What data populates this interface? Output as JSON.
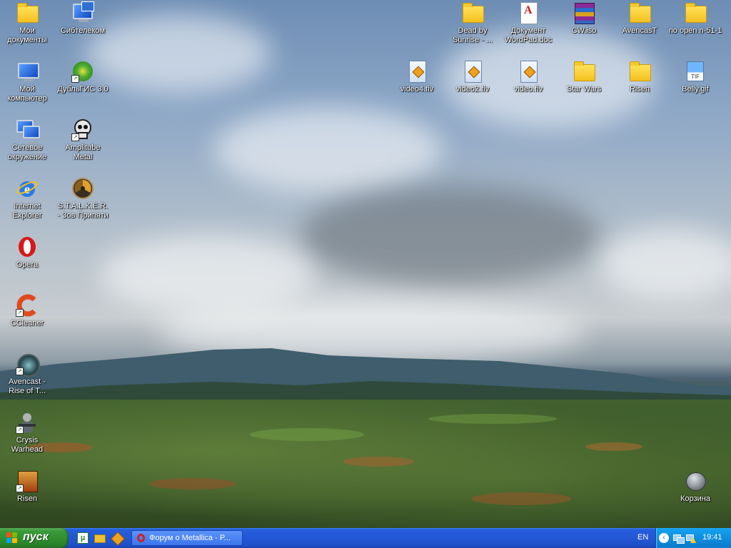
{
  "desktop": {
    "icons_left": [
      {
        "label": "Мои\nдокументы",
        "icon": "folder-documents-icon"
      },
      {
        "label": "Мой\nкомпьютер",
        "icon": "computer-icon"
      },
      {
        "label": "Сетевое\nокружение",
        "icon": "network-icon"
      },
      {
        "label": "Internet\nExplorer",
        "icon": "internet-explorer-icon"
      },
      {
        "label": "Opera",
        "icon": "opera-icon"
      },
      {
        "label": "CCleaner",
        "icon": "ccleaner-icon"
      },
      {
        "label": "Avencast -\nRise of T...",
        "icon": "avencast-icon"
      },
      {
        "label": "Crysis\nWarhead",
        "icon": "crysis-icon"
      },
      {
        "label": "Risen",
        "icon": "risen-game-icon"
      }
    ],
    "icons_second": [
      {
        "label": "Сибтелеком",
        "icon": "sibtelecom-icon"
      },
      {
        "label": "ДубльГИС 3.0",
        "icon": "doublegis-icon"
      },
      {
        "label": "Amplitube\nMetal",
        "icon": "amplitube-icon"
      },
      {
        "label": "S.T.A.L.K.E.R.\n- Зов Припяти",
        "icon": "stalker-icon"
      }
    ],
    "icons_top_right": [
      {
        "label": "Dead by\nSunrise - ...",
        "icon": "folder-icon"
      },
      {
        "label": "Документ\nWordPad.doc",
        "icon": "wordpad-doc-icon"
      },
      {
        "label": "CW.iso",
        "icon": "winrar-iso-icon"
      },
      {
        "label": "AvencasT",
        "icon": "folder-icon"
      },
      {
        "label": "no open n-51-1",
        "icon": "folder-icon"
      }
    ],
    "icons_second_row": [
      {
        "label": "video4.flv",
        "icon": "flv-file-icon"
      },
      {
        "label": "video2.flv",
        "icon": "flv-file-icon"
      },
      {
        "label": "video.flv",
        "icon": "flv-file-icon"
      },
      {
        "label": "Star Wars",
        "icon": "folder-icon"
      },
      {
        "label": "Risen",
        "icon": "folder-icon"
      },
      {
        "label": "Belly.gif",
        "icon": "tif-image-icon",
        "badge": "TIF"
      }
    ],
    "recycle_bin": {
      "label": "Корзина",
      "icon": "recycle-bin-icon"
    }
  },
  "taskbar": {
    "start_label": "пуск",
    "quick_launch": [
      "utorrent-icon",
      "folder-switch-icon",
      "flv-player-icon"
    ],
    "tasks": [
      {
        "label": "Форум о Metallica - P...",
        "icon": "opera-icon"
      }
    ],
    "language": "EN",
    "clock": "19:41"
  },
  "colors": {
    "taskbar_blue": "#245edb",
    "start_green": "#3a9a3a",
    "tray_blue": "#0f8ee0"
  }
}
